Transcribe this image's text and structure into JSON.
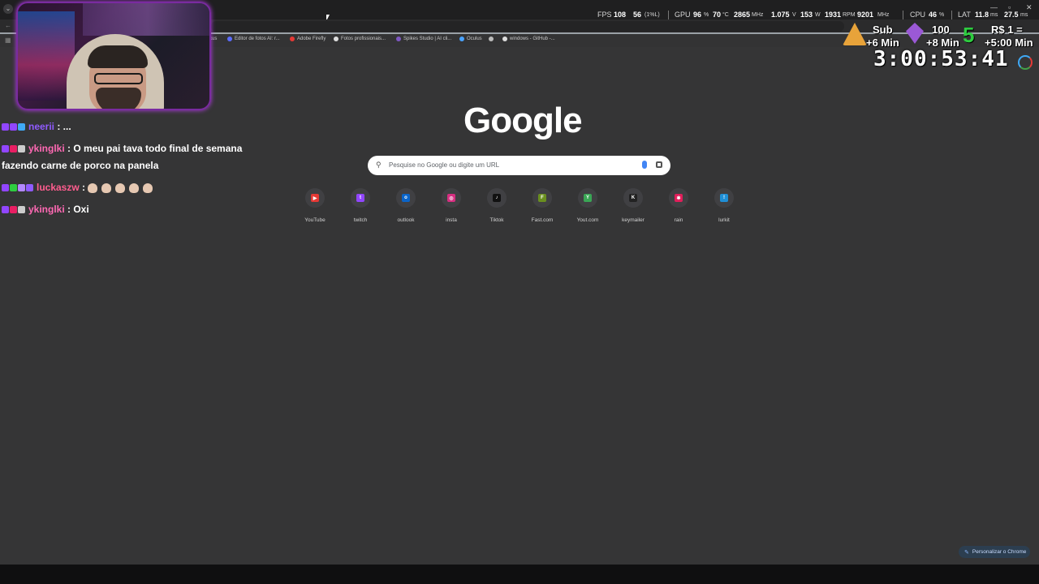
{
  "performance": {
    "fps_label": "FPS",
    "fps_value": "108",
    "fps_low": "56",
    "fps_low_unit": "(1%L)",
    "gpu_label": "GPU",
    "gpu_usage": "96",
    "gpu_usage_unit": "%",
    "gpu_temp": "70",
    "gpu_temp_unit": "°C",
    "gpu_clock": "2865",
    "gpu_clock_unit": "MHz",
    "gpu_voltage": "1.075",
    "gpu_voltage_unit": "V",
    "gpu_power": "153",
    "gpu_power_unit": "W",
    "gpu_fan": "1931",
    "gpu_fan_unit": "RPM",
    "gpu_mem_clock": "9201",
    "gpu_mem_clock_unit": "MHz",
    "cpu_label": "CPU",
    "cpu_usage": "46",
    "cpu_usage_unit": "%",
    "lat_label": "LAT",
    "lat_1": "11.8",
    "lat_1_unit": "ms",
    "lat_2": "27.5",
    "lat_2_unit": "ms"
  },
  "bookmarks": [
    {
      "label": "cus",
      "color": "#888888"
    },
    {
      "label": "Editor de fotos AI: r...",
      "color": "#5b6cff"
    },
    {
      "label": "Adobe Firefly",
      "color": "#e53935"
    },
    {
      "label": "Fotos profissionais...",
      "color": "#dddddd"
    },
    {
      "label": "Spikes Studio | AI cli...",
      "color": "#7e57c2"
    },
    {
      "label": "Oculus",
      "color": "#4aa3ff"
    },
    {
      "label": "",
      "color": "#bbbbbb"
    },
    {
      "label": "windows - GitHub -...",
      "color": "#dddddd"
    }
  ],
  "chat": [
    {
      "user": "neerii",
      "user_color": "#8f5bff",
      "message": " : ...",
      "badges": [
        "#9146ff",
        "#9146ff",
        "#3fa9f5"
      ]
    },
    {
      "user": "ykinglki",
      "user_color": "#ff69b4",
      "message": " : O meu pai tava todo final de semana fazendo carne de porco na panela",
      "badges": [
        "#9146ff",
        "#e91e63",
        "#cccccc"
      ]
    },
    {
      "user": "luckaszw",
      "user_color": "#ff5d8f",
      "message": " : ",
      "badges": [
        "#9146ff",
        "#2ecc40",
        "#b388ff",
        "#8f5bff"
      ],
      "emote_count": 5
    },
    {
      "user": "ykinglki",
      "user_color": "#ff69b4",
      "message": " : Oxi",
      "badges": [
        "#9146ff",
        "#e91e63",
        "#cccccc"
      ]
    }
  ],
  "overlay": {
    "sub_label": "Sub",
    "sub_time": "+6 Min",
    "gem_count": "100",
    "gem_time": "+8 Min",
    "money_icon": "5",
    "money_label": "R$ 1 =",
    "money_time": "+5:00 Min",
    "timer": "3:00:53:41"
  },
  "google": {
    "logo": "Google",
    "search_placeholder": "Pesquise no Google ou digite um URL",
    "shortcuts": [
      {
        "label": "YouTube",
        "glyph": "▶",
        "color": "#e53935"
      },
      {
        "label": "twitch",
        "glyph": "t",
        "color": "#9146ff"
      },
      {
        "label": "outlook",
        "glyph": "o",
        "color": "#0a64c8"
      },
      {
        "label": "insta",
        "glyph": "◎",
        "color": "#d62e80"
      },
      {
        "label": "Tiktok",
        "glyph": "♪",
        "color": "#111111"
      },
      {
        "label": "Fast.com",
        "glyph": "F",
        "color": "#6a8f1f"
      },
      {
        "label": "Yout.com",
        "glyph": "Y",
        "color": "#3aa655"
      },
      {
        "label": "keymailer",
        "glyph": "K",
        "color": "#222222"
      },
      {
        "label": "rain",
        "glyph": "✱",
        "color": "#e01e5a"
      },
      {
        "label": "lurkit",
        "glyph": "!",
        "color": "#1f8fd6"
      }
    ],
    "customize_label": "Personalizar o Chrome"
  }
}
